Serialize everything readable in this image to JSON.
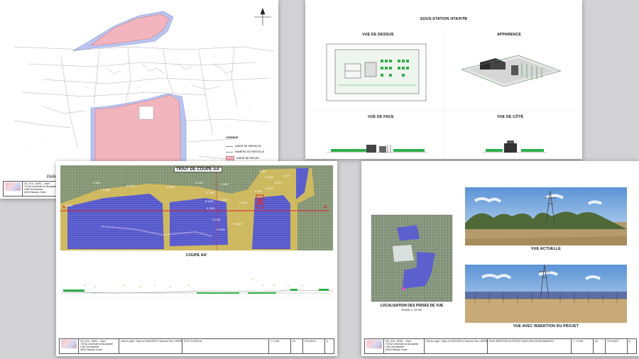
{
  "sheet1": {
    "legend_title": "LÉGENDE",
    "legend_items": [
      "LIMITE DE PARCELLE",
      "NUMÉRO DE PARCELLE",
      "LIMITE DE PROJET"
    ],
    "partial_label": "PARC",
    "titleblock": {
      "company": "CIE_SOL_TAVEL – Tavel",
      "addr1": "73 Rue Université de Montpellier",
      "addr2": "1295 Val Mazamet",
      "addr3": "34000 Mauzac Cedex"
    }
  },
  "sheet2": {
    "title": "SOUS-STATION HTA/HTB",
    "view_top": "VUE DE DESSUS",
    "view_appearance": "APPARENCE",
    "view_front": "VUE DE FACE",
    "view_side": "VUE DE CÔTÉ"
  },
  "sheet3": {
    "section_label": "TRAIT DE COUPE AA'",
    "coupe_label": "COUPE AA'",
    "marker_a": "A",
    "marker_a_prime": "A'",
    "parcel_labels": [
      "E-853",
      "E-1011",
      "E-864",
      "E-1164",
      "E-1161",
      "E-1187",
      "E-1091",
      "E-896",
      "E-1163",
      "E-1153",
      "E-1155",
      "E-1132",
      "E-1008",
      "E-1050",
      "E-1009",
      "E-883",
      "E-1156",
      "E-157",
      "E-877",
      "E-876",
      "E-878"
    ],
    "titleblock": {
      "company": "CIE_SOL_TAVEL – Tavel",
      "addr1": "73 Rue Université de Montpellier",
      "addr2": "1295 Val Mazamet",
      "addr3": "34000 Mauzac Cedex",
      "project": "Cité de projet : Enjeu LE BOUVIER et Tonnerre Parc LORRIE",
      "drawing": "PC02 COUPE AA'",
      "scale": "1 / 2 500",
      "format": "A3",
      "date": "07/11/2022",
      "index": "A"
    }
  },
  "sheet4": {
    "loc_title": "LOCALISATION DES PRISES DE VUE",
    "loc_scale": "Échelle 1 / 15 000",
    "photo1_caption": "VUE ACTUELLE",
    "photo2_caption": "VUE AVEC INSERTION DU PROJET",
    "titleblock": {
      "company": "CIE_SOL_TAVEL – Tavel",
      "addr1": "73 Rue Université de Montpellier",
      "addr2": "1295 Val Mazamet",
      "addr3": "34000 Mauzac Cedex",
      "project": "Cité de projet : Enjeu LE BOUVIER et Tonnerre Parc LORRIE",
      "drawing": "PC06 INSERTION DU PROJET DANS SON ENVIRONNEMENT",
      "scale": "1 / 15 000",
      "format": "A3",
      "date": "07/11/2022",
      "index": "A"
    }
  },
  "colors": {
    "background": "#d2d2d4",
    "parcel_pink": "#f2b5bd",
    "parcel_blue": "#b9c4ef",
    "panels": "#5a5bd0",
    "buffer_yellow": "#e6c45a",
    "section_red": "#d8262f"
  }
}
